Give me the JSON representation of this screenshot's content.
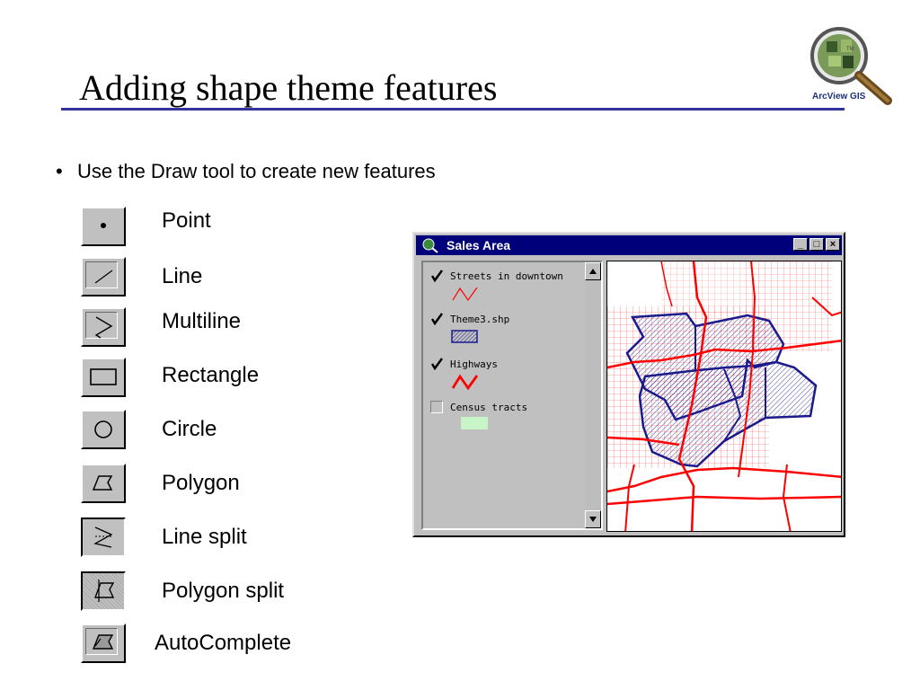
{
  "slide": {
    "title": "Adding shape theme features",
    "bullet": "Use the Draw tool to create new features",
    "logo_text": "ArcView GIS",
    "logo_tm": "TM"
  },
  "tools": [
    {
      "label": "Point",
      "icon": "point-tool-icon"
    },
    {
      "label": "Line",
      "icon": "line-tool-icon"
    },
    {
      "label": "Multiline",
      "icon": "multiline-tool-icon"
    },
    {
      "label": "Rectangle",
      "icon": "rectangle-tool-icon"
    },
    {
      "label": "Circle",
      "icon": "circle-tool-icon"
    },
    {
      "label": "Polygon",
      "icon": "polygon-tool-icon"
    },
    {
      "label": "Line split",
      "icon": "line-split-tool-icon"
    },
    {
      "label": "Polygon split",
      "icon": "polygon-split-tool-icon"
    },
    {
      "label": "AutoComplete",
      "icon": "autocomplete-tool-icon"
    }
  ],
  "window": {
    "title": "Sales Area",
    "buttons": {
      "minimize": "_",
      "maximize": "□",
      "close": "×"
    },
    "themes": [
      {
        "name": "Streets in downtown",
        "checked": true
      },
      {
        "name": "Theme3.shp",
        "checked": true
      },
      {
        "name": "Highways",
        "checked": true
      },
      {
        "name": "Census tracts",
        "checked": false
      }
    ]
  },
  "colors": {
    "title_rule": "#33339b",
    "titlebar": "#00007b",
    "streets": "#ff0000",
    "polygon_outline": "#1a1a8c",
    "census_fill": "#c8f5c8"
  }
}
